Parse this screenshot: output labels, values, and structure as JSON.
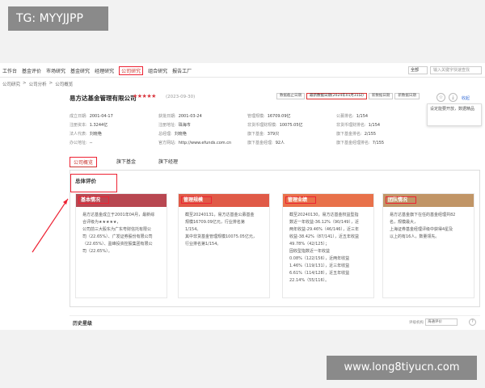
{
  "watermark_top": "TG: MYYJJPP",
  "watermark_bottom": "www.long8tiyucn.com",
  "nav": {
    "items": [
      "工作台",
      "基金评价",
      "市场研究",
      "基金研究",
      "经理研究",
      "公司研究",
      "组合研究",
      "报告工厂"
    ],
    "active_index": 5,
    "select_value": "全部",
    "search_placeholder": "输入关键字快速查找"
  },
  "breadcrumb": [
    "公司研究",
    ">",
    "公司分析",
    ">",
    "公司概览"
  ],
  "company": {
    "name": "易方达基金管理有限公司",
    "stars": "★★★★★",
    "date": "(2023-09-30)",
    "buttons": [
      "数据截止日期",
      "最新数据日期(2024年01月31日)",
      "新数据日期",
      "新数据日期"
    ],
    "more": "收起"
  },
  "popup_text": "设定能要开放，数据精品",
  "info": {
    "row1": [
      {
        "k": "成立日期:",
        "v": "2001-04-17"
      },
      {
        "k": "获批日期:",
        "v": "2001-03-24"
      },
      {
        "k": "管理规模:",
        "v": "16709.09亿"
      },
      {
        "k": "公募排名:",
        "v": "1/154"
      }
    ],
    "row2": [
      {
        "k": "注册资本:",
        "v": "1.3244亿"
      },
      {
        "k": "注册地址:",
        "v": "珠海市"
      },
      {
        "k": "非货币理财规模:",
        "v": "10075.05亿"
      },
      {
        "k": "非货币理财排名:",
        "v": "1/154"
      }
    ],
    "row3": [
      {
        "k": "法人代表:",
        "v": "刘晓艳"
      },
      {
        "k": "总经理:",
        "v": "刘晓艳"
      },
      {
        "k": "旗下基金:",
        "v": "379只"
      },
      {
        "k": "旗下基金排名:",
        "v": "2/155"
      }
    ],
    "row4": [
      {
        "k": "办公地址:",
        "v": "--"
      },
      {
        "k": "官方网站:",
        "v": "http://www.efunds.com.cn"
      },
      {
        "k": "旗下基金经理:",
        "v": "92人"
      },
      {
        "k": "旗下基金经理排名:",
        "v": "7/155"
      }
    ]
  },
  "tabs": [
    "公司概览",
    "旗下基金",
    "旗下经理"
  ],
  "eval_title": "总体评价",
  "cards": [
    {
      "title": "基本情况",
      "lines": [
        "易方达基金成立于2001年04月，最新综",
        "合评级为★★★★★，",
        "公司前三大股东为广东粤财信托有限公",
        "司（22.65%）、广发证券股份有限公司",
        "（22.65%）、盈峰投资控股集团有限公",
        "司（22.65%）。"
      ]
    },
    {
      "title": "管理规模",
      "lines": [
        "截至20240131，易方达基金公募基金",
        "规模16709.09亿元，行业排名第",
        "1/154。",
        "其中非货基金管理规模10075.05亿元，",
        "行业排名第1/154。"
      ]
    },
    {
      "title": "管理业绩",
      "lines": [
        "截至20240130，易方达基金权益型指",
        "数近一年收益-36.12%（90/149），近",
        "两年收益-29.46%（46/146），近三年",
        "收益-38.42%（87/141），近五年收益",
        "49.78%（42/125）；",
        "固收型指数近一年收益",
        "0.08%（122/156），近两年收益",
        "1.46%（119/131），近三年收益",
        "6.61%（114/128），近五年收益",
        "22.14%（55/116）。"
      ]
    },
    {
      "title": "团队情况",
      "lines": [
        "易方达基金旗下在任的基金经理共82",
        "名，规模最大，",
        "上海证券基金经理评级中获得4星及",
        "以上的有16人，数量领先。"
      ]
    }
  ],
  "history": {
    "title": "历史星级",
    "select_label": "评级机构",
    "select_value": "海通评价"
  }
}
